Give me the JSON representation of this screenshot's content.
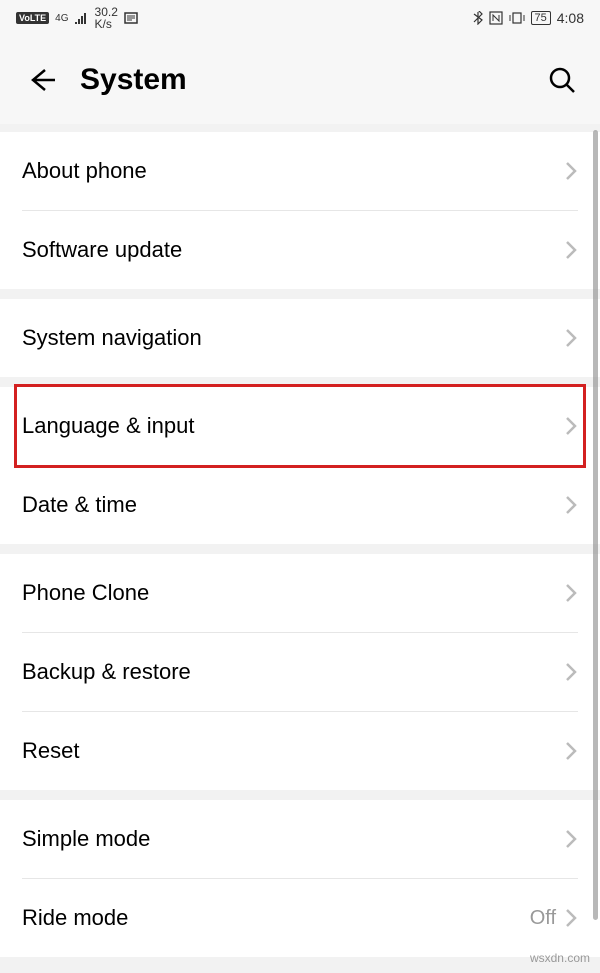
{
  "status": {
    "volte": "VoLTE",
    "network": "4G",
    "speed_num": "30.2",
    "speed_unit": "K/s",
    "battery": "75",
    "time": "4:08"
  },
  "header": {
    "title": "System"
  },
  "rows": {
    "about_phone": "About phone",
    "software_update": "Software update",
    "system_navigation": "System navigation",
    "language_input": "Language & input",
    "date_time": "Date & time",
    "phone_clone": "Phone Clone",
    "backup_restore": "Backup & restore",
    "reset": "Reset",
    "simple_mode": "Simple mode",
    "ride_mode": "Ride mode",
    "ride_mode_value": "Off"
  },
  "watermark": "wsxdn.com"
}
